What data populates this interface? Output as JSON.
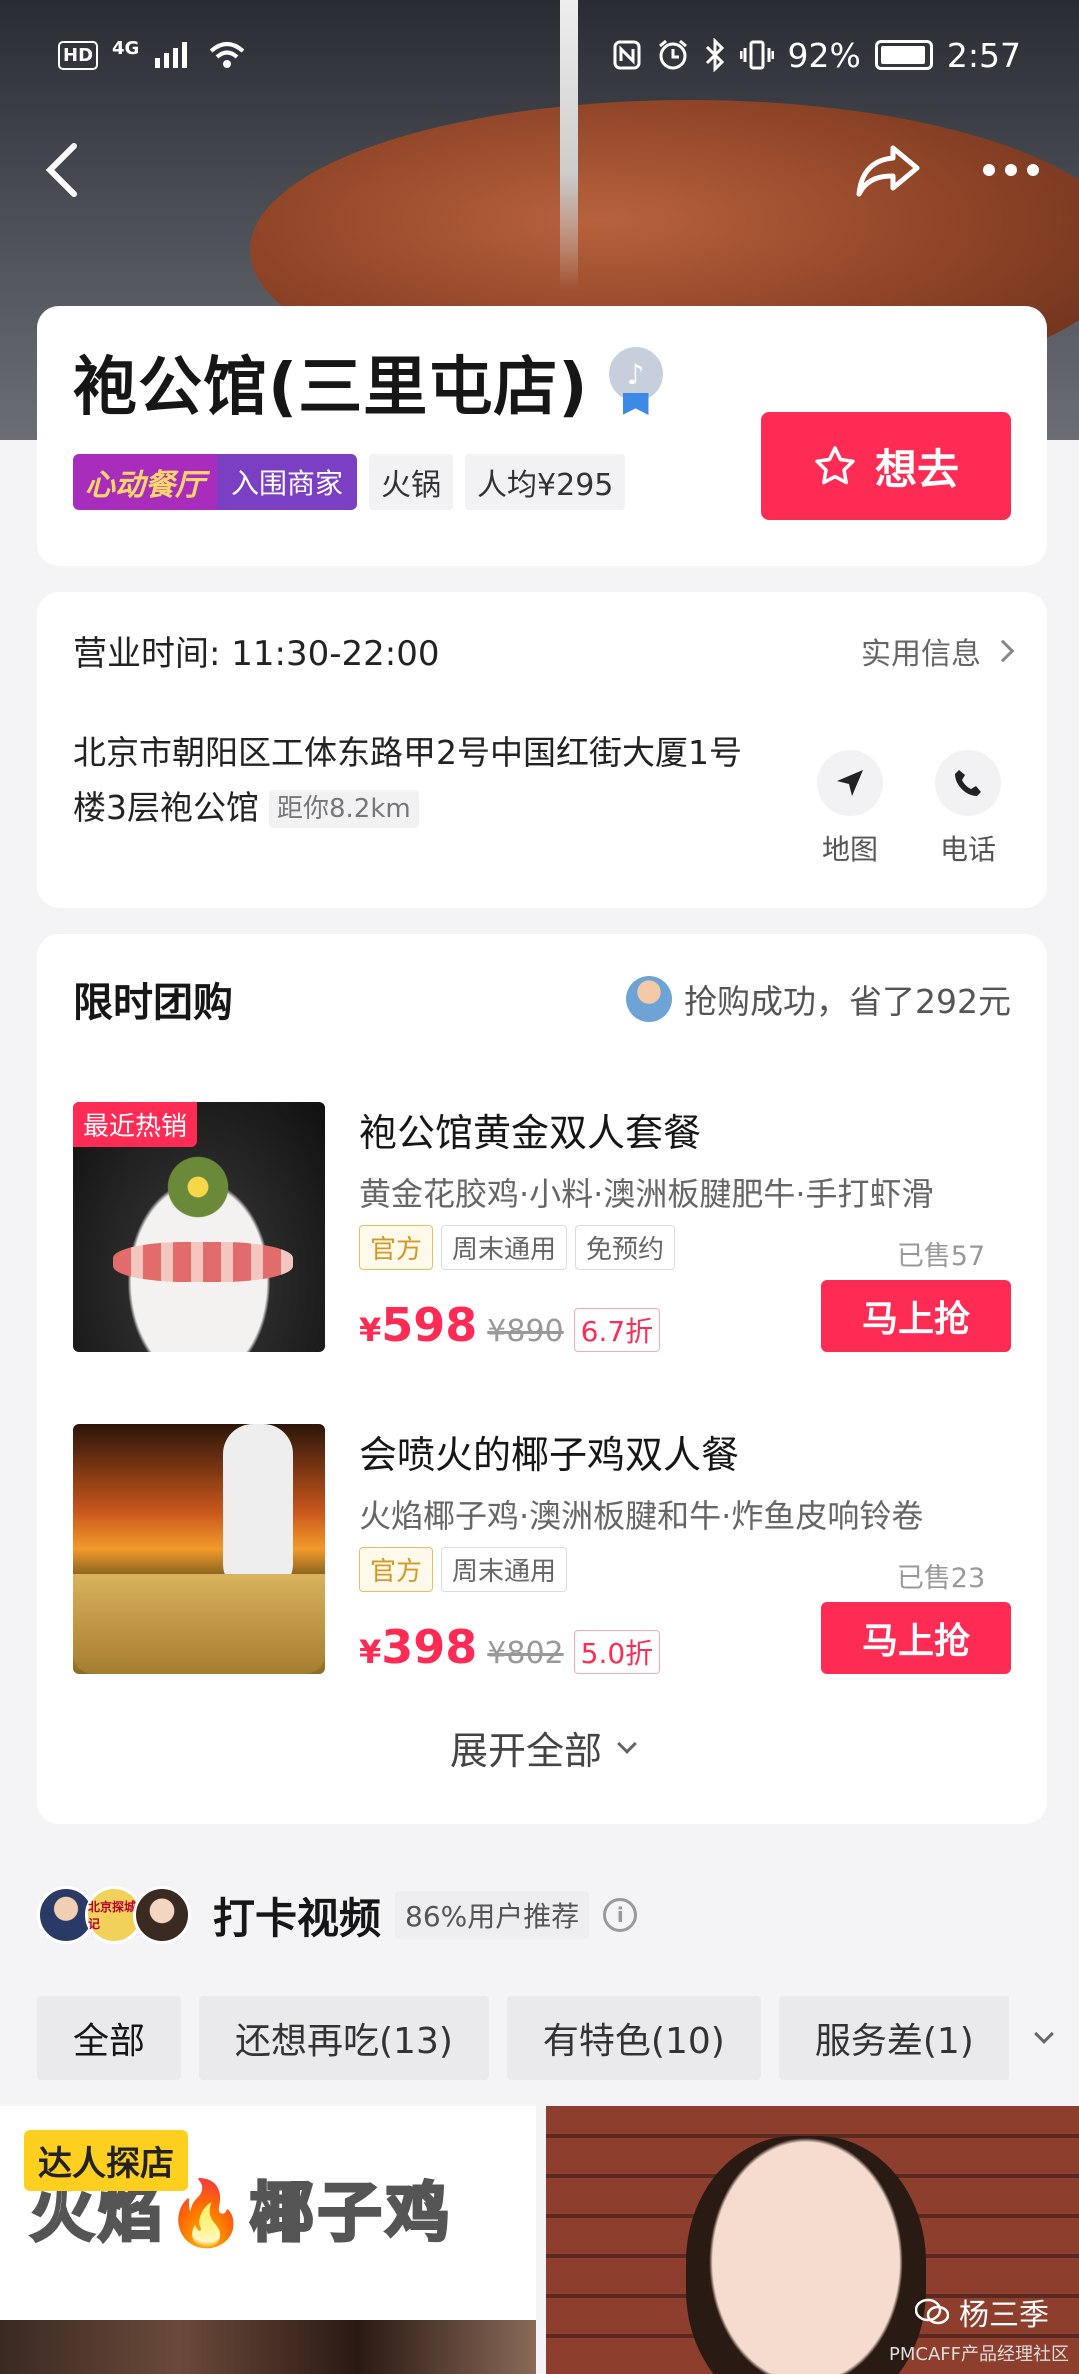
{
  "status_bar": {
    "hd": "HD",
    "network": "4G",
    "battery": "92%",
    "time": "2:57"
  },
  "store": {
    "name": "袍公馆(三里屯店)",
    "award_logo": "心动餐厅",
    "award_label": "入围商家",
    "cuisine": "火锅",
    "avg_price": "人均¥295",
    "want_label": "想去"
  },
  "info": {
    "hours": "营业时间: 11:30-22:00",
    "practical_info": "实用信息",
    "address": "北京市朝阳区工体东路甲2号中国红街大厦1号楼3层袍公馆",
    "distance": "距你8.2km",
    "map_label": "地图",
    "phone_label": "电话"
  },
  "deals_section": {
    "title": "限时团购",
    "note": "抢购成功，省了292元",
    "expand_label": "展开全部",
    "items": [
      {
        "badge": "最近热销",
        "name": "袍公馆黄金双人套餐",
        "desc": "黄金花胶鸡·小料·澳洲板腱肥牛·手打虾滑",
        "tags": [
          "官方",
          "周末通用",
          "免预约"
        ],
        "sold": "已售57",
        "price_symbol": "¥",
        "price": "598",
        "original": "¥890",
        "discount": "6.7折",
        "buy_label": "马上抢"
      },
      {
        "name": "会喷火的椰子鸡双人餐",
        "desc": "火焰椰子鸡·澳洲板腱和牛·炸鱼皮响铃卷",
        "tags": [
          "官方",
          "周末通用"
        ],
        "sold": "已售23",
        "price_symbol": "¥",
        "price": "398",
        "original": "¥802",
        "discount": "5.0折",
        "buy_label": "马上抢"
      }
    ]
  },
  "videos_section": {
    "title": "打卡视频",
    "recommend": "86%用户推荐",
    "avatar2_text": "北京探城记",
    "filters": [
      "全部",
      "还想再吃(13)",
      "有特色(10)",
      "服务差(1)"
    ],
    "video1_badge": "达人探店",
    "video1_caption": "火焰🔥椰子鸡",
    "watermark": "杨三季",
    "watermark_sub": "PMCAFF产品经理社区"
  },
  "colors": {
    "accent": "#fe2c55",
    "award_purple": "#a92dbd",
    "official_gold": "#d09a26"
  }
}
